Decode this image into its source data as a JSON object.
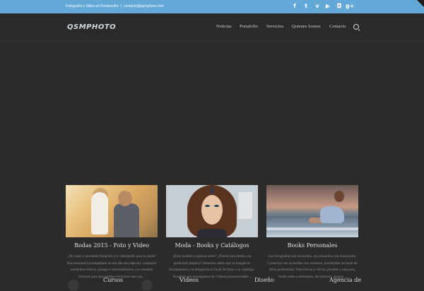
{
  "topbar": {
    "tagline": "Fotografía y Video en Pontevedra",
    "separator": "|",
    "email": "contacto@qsmphoto.com",
    "social_icons": [
      "facebook-icon",
      "twitter-icon",
      "vimeo-icon",
      "youtube-icon",
      "instagram-icon",
      "google-plus-icon"
    ],
    "social_glyphs": [
      "f",
      "t",
      "v",
      "▶",
      "◘",
      "g+"
    ],
    "background": "#64a8d8"
  },
  "header": {
    "logo": "QSMPHOTO",
    "nav": [
      "Noticias",
      "Portafolio",
      "Servicios",
      "Quienes Somos",
      "Contacto"
    ]
  },
  "cards": [
    {
      "title": "Bodas 2015 - Foto y Video",
      "text": "¿Te casas y necesitas fotógrafo y/o videógrafo para tu boda? Nos encantará acompañarte en ese día tan especial, compartir momentos únicos contigo e inmortalizarlos con nuestras cámaras para que puedas revivirlos una vez..."
    },
    {
      "title": "Moda - Books y Catálogos",
      "text": "¿Eres modelo o quieres serlo? ¿Tienes una tienda con productos propios? Entonces sabes que tu imagen es fundamental y tu imagen es tu book de fotos o tu catálogo. Nosotros nos encargamos de Vídeos promocionales..."
    },
    {
      "title": "Books Personales",
      "text": "Las fotografías son recuerdos, los recuerdos son emociones. Construye tus recuerdos con nosotros, haciéndote un book de fotos profesional. Para chicas y chicos, jóvenes y mayores, books bebe o embarazo, de músicos, grupos..."
    }
  ],
  "bottom_links": [
    "Cursos",
    "Videos",
    "Diseño",
    "Agencia de"
  ],
  "colors": {
    "background": "#2b2b2b",
    "accent": "#64a8d8"
  }
}
